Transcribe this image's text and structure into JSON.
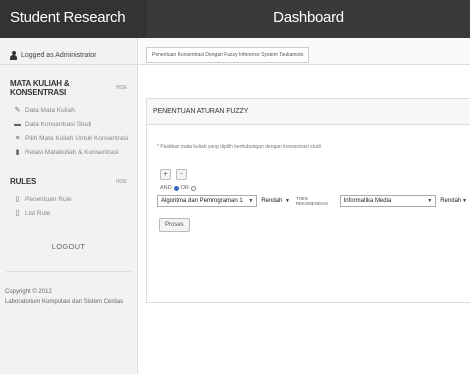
{
  "app": {
    "brand": "Student Research",
    "page_title": "Dashboard"
  },
  "sidebar": {
    "login_text": "Logged as Administrator",
    "section1": {
      "title": "MATA KULIAH & KONSENTRASI",
      "tag": "HIDE",
      "items": [
        {
          "label": "Data Mata Kuliah",
          "icon": "pencil-icon"
        },
        {
          "label": "Data Konsentrasi Studi",
          "icon": "folder-icon"
        },
        {
          "label": "Pilih Mata Kuliah Untuk Konsentrasi",
          "icon": "list-icon"
        },
        {
          "label": "Relasi Matakuliah & Konsentrasi",
          "icon": "file-icon"
        }
      ]
    },
    "section2": {
      "title": "RULES",
      "tag": "HIDE",
      "items": [
        {
          "label": "Penentuan Rule",
          "icon": "document-icon"
        },
        {
          "label": "List Rule",
          "icon": "document-icon"
        }
      ]
    },
    "logout_label": "LOGOUT",
    "copyright_line1": "Copyright © 2012",
    "copyright_line2": "Laboratorium Komputasi dan Sistem Cerdas"
  },
  "main": {
    "breadcrumb": "Penentuan Konsentrasi Dengan Fuzzy Inference System Tsukamoto",
    "panel_title": "PENENTUAN ATURAN FUZZY",
    "note": "* Pastikan mata kuliah yang dipilih berhubungan dengan konsentrasi studi",
    "add_label": "+",
    "remove_label": "-",
    "and_label": "AND",
    "or_label": "OR",
    "selected_operator": "AND",
    "course_select": "Algoritma dan Pemrograman 1",
    "level_select_1": "Rendah",
    "then_label": "THEN REKOMENDASI",
    "concentration_select": "Informatika Media",
    "level_select_2": "Rendah",
    "process_label": "Proses"
  }
}
